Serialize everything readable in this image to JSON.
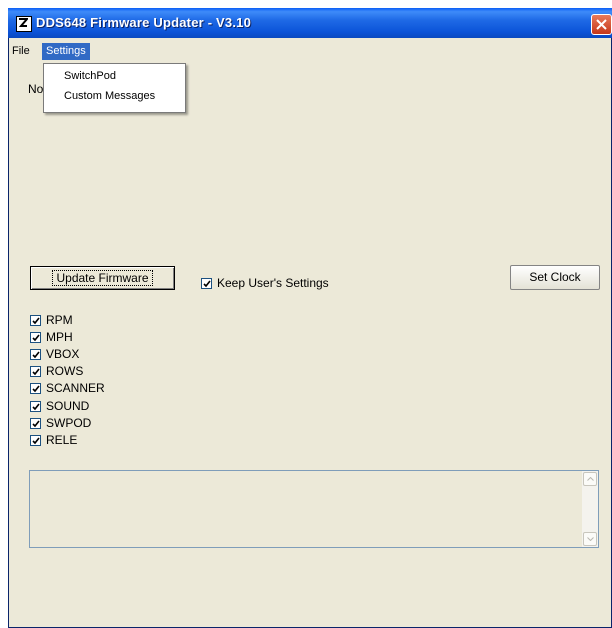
{
  "window": {
    "title": "DDS648 Firmware Updater - V3.10",
    "icon": "app-logo-icon",
    "close_icon": "close-icon"
  },
  "menu": {
    "file": "File",
    "settings": "Settings"
  },
  "settings_menu": {
    "items": [
      "SwitchPod",
      "Custom Messages"
    ]
  },
  "status": {
    "partial_text": "No"
  },
  "buttons": {
    "update_firmware": "Update Firmware",
    "set_clock": "Set Clock"
  },
  "keep_settings": {
    "label": "Keep User's Settings",
    "checked": true
  },
  "options": [
    {
      "label": "RPM",
      "checked": true
    },
    {
      "label": "MPH",
      "checked": true
    },
    {
      "label": "VBOX",
      "checked": true
    },
    {
      "label": "ROWS",
      "checked": true
    },
    {
      "label": "SCANNER",
      "checked": true
    },
    {
      "label": "SOUND",
      "checked": true
    },
    {
      "label": "SWPOD",
      "checked": true
    },
    {
      "label": "RELE",
      "checked": true
    }
  ],
  "log": {
    "content": ""
  },
  "colors": {
    "titlebar": "#0b53d8",
    "menu_highlight": "#316ac5",
    "window_bg": "#ece9d8",
    "close_button": "#c6371a"
  }
}
